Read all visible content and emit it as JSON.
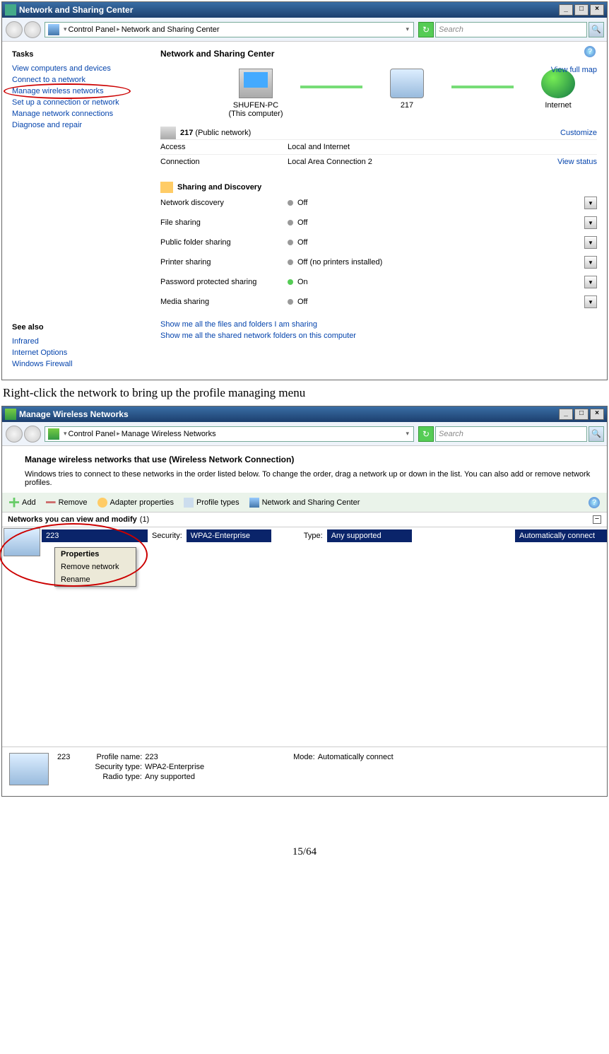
{
  "window1": {
    "title": "Network and Sharing Center",
    "breadcrumb": {
      "root": "Control Panel",
      "leaf": "Network and Sharing Center"
    },
    "search_placeholder": "Search",
    "tasks_header": "Tasks",
    "tasks": [
      "View computers and devices",
      "Connect to a network",
      "Manage wireless networks",
      "Set up a connection or network",
      "Manage network connections",
      "Diagnose and repair"
    ],
    "see_also_header": "See also",
    "see_also": [
      "Infrared",
      "Internet Options",
      "Windows Firewall"
    ],
    "main_header": "Network and Sharing Center",
    "view_full_map": "View full map",
    "map_nodes": {
      "pc": "SHUFEN-PC",
      "pc_sub": "(This computer)",
      "gateway": "217",
      "internet": "Internet"
    },
    "network_name": "217",
    "network_type": "(Public network)",
    "customize": "Customize",
    "access_label": "Access",
    "access_value": "Local and Internet",
    "connection_label": "Connection",
    "connection_value": "Local Area Connection 2",
    "view_status": "View status",
    "sharing_header": "Sharing and Discovery",
    "sharing_rows": [
      {
        "label": "Network discovery",
        "value": "Off",
        "on": false
      },
      {
        "label": "File sharing",
        "value": "Off",
        "on": false
      },
      {
        "label": "Public folder sharing",
        "value": "Off",
        "on": false
      },
      {
        "label": "Printer sharing",
        "value": "Off (no printers installed)",
        "on": false
      },
      {
        "label": "Password protected sharing",
        "value": "On",
        "on": true
      },
      {
        "label": "Media sharing",
        "value": "Off",
        "on": false
      }
    ],
    "show_link1": "Show me all the files and folders I am sharing",
    "show_link2": "Show me all the shared network folders on this computer"
  },
  "caption": "Right-click the network to bring up the profile managing menu",
  "window2": {
    "title": "Manage Wireless Networks",
    "breadcrumb": {
      "root": "Control Panel",
      "leaf": "Manage Wireless Networks"
    },
    "search_placeholder": "Search",
    "intro_header": "Manage wireless networks that use (Wireless Network Connection)",
    "intro_body": "Windows tries to connect to these networks in the order listed below. To change the order, drag a network up or down in the list. You can also add or remove network profiles.",
    "toolbar": {
      "add": "Add",
      "remove": "Remove",
      "adapter": "Adapter properties",
      "profile": "Profile types",
      "center": "Network and Sharing Center"
    },
    "list_header_prefix": "Networks you can view and modify",
    "list_header_count": " (1)",
    "row": {
      "name": "223",
      "security_label": "Security:",
      "security_value": "WPA2-Enterprise",
      "type_label": "Type:",
      "type_value": "Any supported",
      "auto": "Automatically connect"
    },
    "context_menu": [
      "Properties",
      "Remove network",
      "Rename"
    ],
    "details": {
      "name": "223",
      "profile_name_k": "Profile name:",
      "profile_name_v": "223",
      "security_k": "Security type:",
      "security_v": "WPA2-Enterprise",
      "radio_k": "Radio type:",
      "radio_v": "Any supported",
      "mode_k": "Mode:",
      "mode_v": "Automatically connect"
    }
  },
  "page_number": "15/64"
}
